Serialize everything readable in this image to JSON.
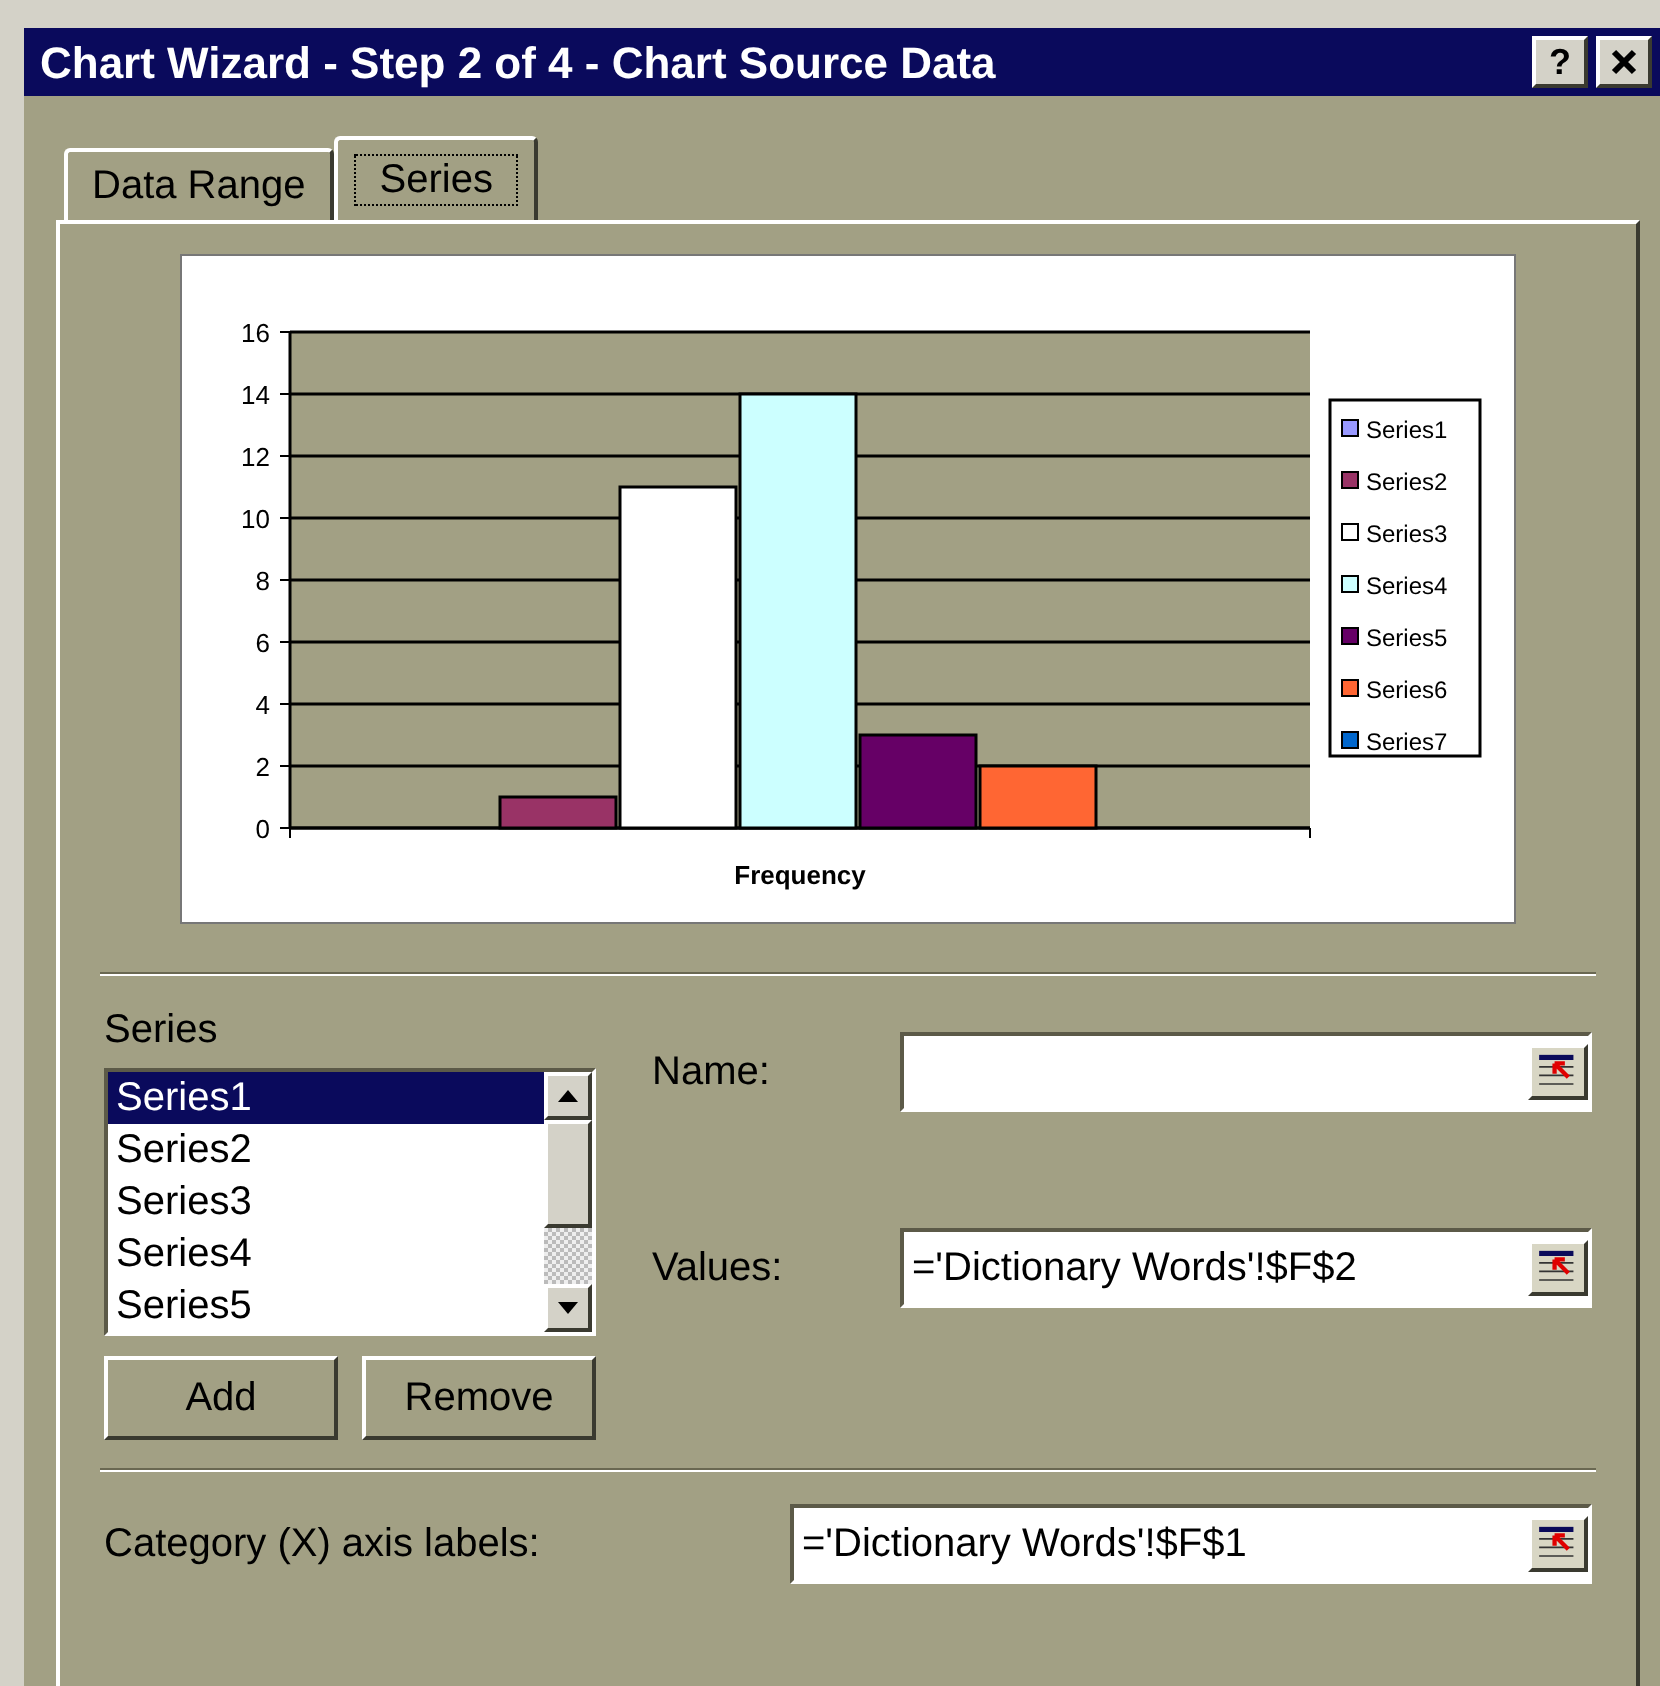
{
  "window": {
    "title": "Chart Wizard - Step 2 of 4 - Chart Source Data",
    "buttons": [
      {
        "kind": "help",
        "label": "?"
      },
      {
        "kind": "close"
      }
    ]
  },
  "tabs": [
    {
      "label": "Data Range",
      "selected": false
    },
    {
      "label": "Series",
      "selected": true
    }
  ],
  "chart": {
    "chart_data": {
      "type": "bar",
      "categories": [
        "Frequency"
      ],
      "series": [
        {
          "name": "Series1",
          "color": "#9999ff",
          "values": [
            0
          ]
        },
        {
          "name": "Series2",
          "color": "#993366",
          "values": [
            1
          ]
        },
        {
          "name": "Series3",
          "color": "#ffffff",
          "values": [
            11
          ]
        },
        {
          "name": "Series4",
          "color": "#ccffff",
          "values": [
            14
          ]
        },
        {
          "name": "Series5",
          "color": "#660066",
          "values": [
            3
          ]
        },
        {
          "name": "Series6",
          "color": "#ff6633",
          "values": [
            2
          ]
        },
        {
          "name": "Series7",
          "color": "#0066cc",
          "values": [
            0
          ]
        }
      ],
      "grid": true,
      "legend": true,
      "ylim": [
        0,
        16
      ],
      "yticks": [
        0,
        2,
        4,
        6,
        8,
        10,
        12,
        14,
        16
      ]
    }
  },
  "series_list": {
    "label": "Series",
    "items": [
      {
        "label": "Series1",
        "selected": true
      },
      {
        "label": "Series2",
        "selected": false
      },
      {
        "label": "Series3",
        "selected": false
      },
      {
        "label": "Series4",
        "selected": false
      },
      {
        "label": "Series5",
        "selected": false
      }
    ]
  },
  "series_buttons": [
    {
      "label": "Add"
    },
    {
      "label": "Remove"
    }
  ],
  "fields": [
    {
      "label": "Name:"
    },
    {
      "label": "Values:",
      "value": "='Dictionary Words'!$F$2"
    }
  ],
  "category_field": {
    "label": "Category (X) axis labels:",
    "value": "='Dictionary Words'!$F$1"
  }
}
